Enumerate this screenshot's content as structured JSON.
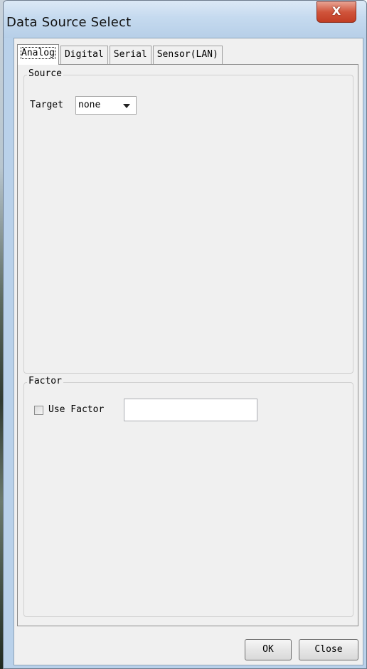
{
  "window": {
    "title": "Data Source Select",
    "close_glyph": "X"
  },
  "tabs": [
    {
      "label": "Analog",
      "active": true
    },
    {
      "label": "Digital",
      "active": false
    },
    {
      "label": "Serial",
      "active": false
    },
    {
      "label": "Sensor(LAN)",
      "active": false
    }
  ],
  "source": {
    "group_title": "Source",
    "target_label": "Target",
    "target_value": "none"
  },
  "factor": {
    "group_title": "Factor",
    "use_factor_label": "Use Factor",
    "use_factor_checked": false,
    "factor_value": ""
  },
  "footer": {
    "ok_label": "OK",
    "close_label": "Close"
  },
  "icons": {
    "close": "close-icon",
    "dropdown": "chevron-down-icon"
  },
  "colors": {
    "close_button": "#c94a32",
    "titlebar": "#c5daef",
    "client_bg": "#f0f0f0"
  }
}
